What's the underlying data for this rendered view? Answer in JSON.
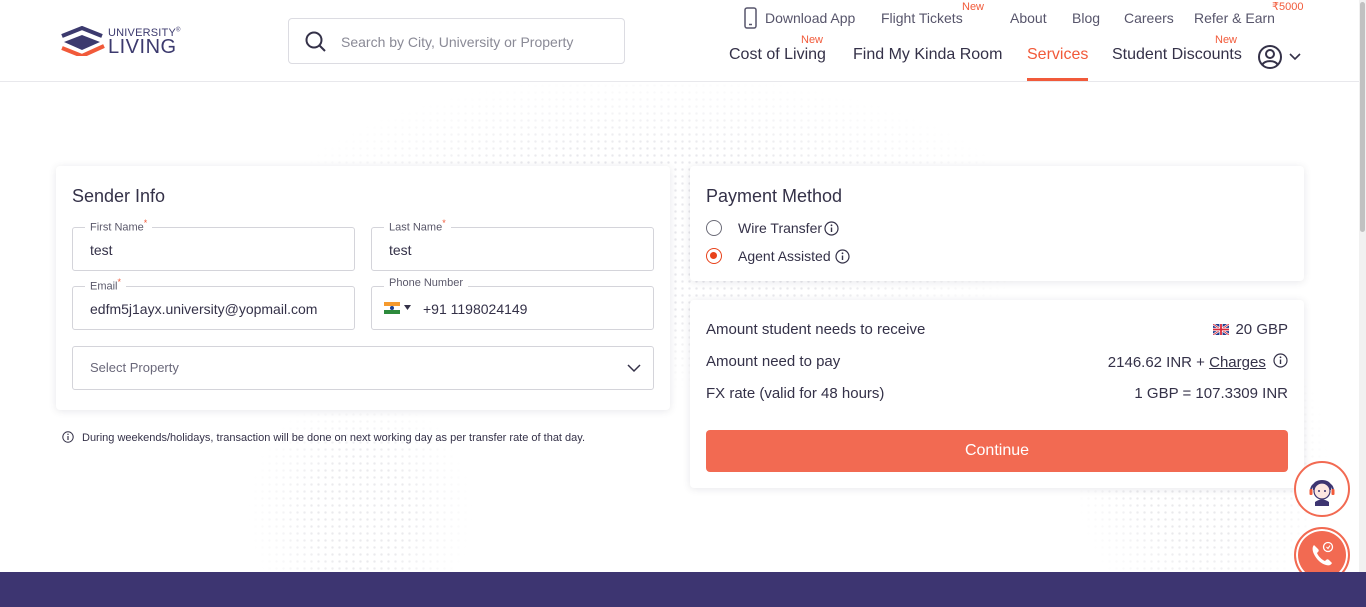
{
  "header": {
    "logo": {
      "line1": "UNIVERSITY",
      "reg": "®",
      "line2": "LIVING"
    },
    "search": {
      "placeholder": "Search by City, University or Property"
    },
    "top_links": {
      "download_app": "Download App",
      "flight_tickets": "Flight Tickets",
      "flight_tickets_tag": "New",
      "about": "About",
      "blog": "Blog",
      "careers": "Careers",
      "refer_earn": "Refer & Earn",
      "refer_earn_tag": "₹5000"
    },
    "main_nav": {
      "cost_of_living": "Cost of Living",
      "cost_of_living_tag": "New",
      "find_room": "Find My Kinda Room",
      "services": "Services",
      "student_discounts": "Student Discounts",
      "student_discounts_tag": "New"
    },
    "active_nav": "services"
  },
  "sender": {
    "title": "Sender Info",
    "first_name": {
      "label": "First Name",
      "value": "test"
    },
    "last_name": {
      "label": "Last Name",
      "value": "test"
    },
    "email": {
      "label": "Email",
      "value": "edfm5j1ayx.university@yopmail.com"
    },
    "phone": {
      "label": "Phone Number",
      "value": "+91 1198024149",
      "country": "IN"
    },
    "property": {
      "placeholder": "Select Property"
    },
    "required_mark": "*"
  },
  "note": "During weekends/holidays, transaction will be done on next working day as per transfer rate of that day.",
  "payment": {
    "title": "Payment Method",
    "options": [
      {
        "label": "Wire Transfer",
        "selected": false
      },
      {
        "label": "Agent Assisted",
        "selected": true
      }
    ]
  },
  "amounts": {
    "receive_label": "Amount student needs to receive",
    "receive_value": "20 GBP",
    "pay_label": "Amount need to pay",
    "pay_value": "2146.62 INR +",
    "charges_link": "Charges",
    "fx_label": "FX rate (valid for 48 hours)",
    "fx_value": "1 GBP = 107.3309 INR"
  },
  "continue_label": "Continue",
  "colors": {
    "accent": "#f15a3a",
    "button": "#f26a52",
    "footer": "#3d3571",
    "text": "#343148"
  },
  "icons": [
    "search-icon",
    "phone-icon",
    "user-circle-icon",
    "chevron-down-icon",
    "info-icon",
    "uk-flag-icon",
    "india-flag-icon",
    "support-agent-icon",
    "call-icon"
  ]
}
